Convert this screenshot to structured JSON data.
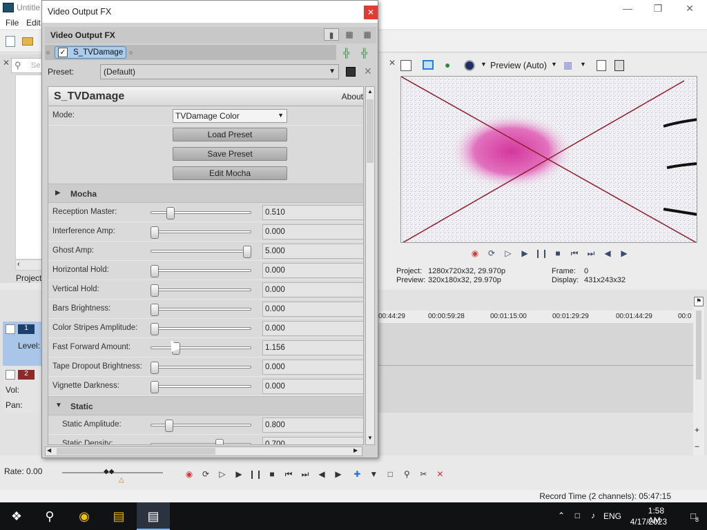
{
  "main": {
    "title": "Untitle",
    "menu": [
      "File",
      "Edit"
    ],
    "search_placeholder": "Se",
    "project_tab": "Project",
    "level_label": "Level:",
    "vol_label": "Vol:",
    "pan_label": "Pan:",
    "track1_num": "1",
    "track2_num": "2",
    "rate": "Rate: 0.00",
    "record_time": "Record Time (2 channels): 05:47:15"
  },
  "preview": {
    "mode": "Preview (Auto)",
    "project": "1280x720x32, 29.970p",
    "preview_val": "320x180x32, 29.970p",
    "frame_label": "Frame:",
    "frame": "0",
    "display_label": "Display:",
    "display": "431x243x32",
    "project_label": "Project:",
    "preview_label": "Preview:"
  },
  "ruler": [
    "00:44:29",
    "00:00:59:28",
    "00:01:15:00",
    "00:01:29:29",
    "00:01:44:29",
    "00:0"
  ],
  "fx": {
    "title": "Video Output FX",
    "header": "Video Output FX",
    "chain_item": "S_TVDamage",
    "preset_label": "Preset:",
    "preset_value": "(Default)",
    "plugin_name": "S_TVDamage",
    "about": "About",
    "mode_label": "Mode:",
    "mode_value": "TVDamage Color",
    "buttons": [
      "Load Preset",
      "Save Preset",
      "Edit Mocha"
    ],
    "section_mocha": "Mocha",
    "section_static": "Static",
    "params": [
      {
        "label": "Reception Master:",
        "value": "0.510",
        "pos": 0.17
      },
      {
        "label": "Interference Amp:",
        "value": "0.000",
        "pos": 0.0
      },
      {
        "label": "Ghost Amp:",
        "value": "5.000",
        "pos": 1.0
      },
      {
        "label": "Horizontal Hold:",
        "value": "0.000",
        "pos": 0.0
      },
      {
        "label": "Vertical Hold:",
        "value": "0.000",
        "pos": 0.0
      },
      {
        "label": "Bars Brightness:",
        "value": "0.000",
        "pos": 0.0
      },
      {
        "label": "Color Stripes Amplitude:",
        "value": "0.000",
        "pos": 0.0
      },
      {
        "label": "Fast Forward Amount:",
        "value": "1.156",
        "pos": 0.23
      },
      {
        "label": "Tape Dropout Brightness:",
        "value": "0.000",
        "pos": 0.0
      },
      {
        "label": "Vignette Darkness:",
        "value": "0.000",
        "pos": 0.0
      }
    ],
    "static_params": [
      {
        "label": "Static Amplitude:",
        "value": "0.800",
        "pos": 0.16
      },
      {
        "label": "Static Density:",
        "value": "0.700",
        "pos": 0.7
      }
    ]
  },
  "taskbar": {
    "lang": "ENG",
    "time": "1:58 AM",
    "date": "4/17/2023",
    "notif": "8"
  }
}
